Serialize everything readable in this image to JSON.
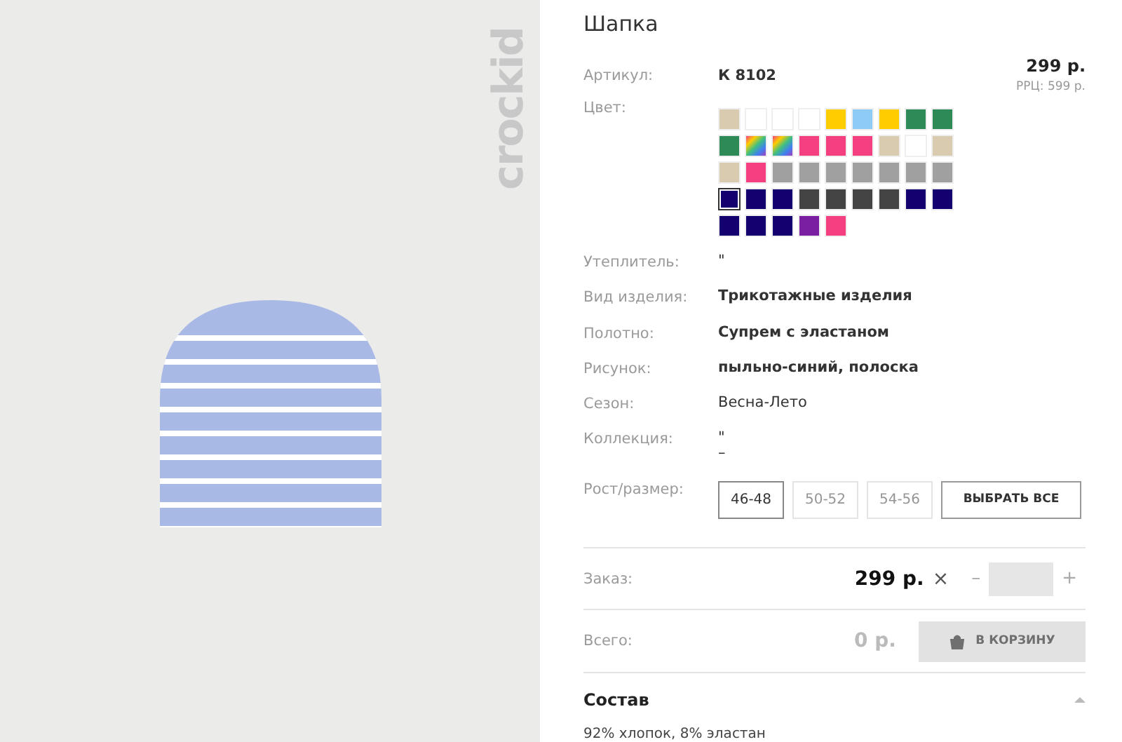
{
  "logo": {
    "text": "crockid"
  },
  "product": {
    "title": "Шапка",
    "article_label": "Артикул:",
    "article": "К 8102",
    "price": "299 р.",
    "rrp": "РРЦ: 599 р."
  },
  "color": {
    "label": "Цвет:",
    "swatches": [
      {
        "kind": "solid",
        "color": "#d8cbb0",
        "selected": false
      },
      {
        "kind": "solid",
        "color": "#ffffff",
        "selected": false
      },
      {
        "kind": "solid",
        "color": "#ffffff",
        "selected": false
      },
      {
        "kind": "solid",
        "color": "#ffffff",
        "selected": false
      },
      {
        "kind": "solid",
        "color": "#ffcc00",
        "selected": false
      },
      {
        "kind": "solid",
        "color": "#8ecbf5",
        "selected": false
      },
      {
        "kind": "solid",
        "color": "#ffcc00",
        "selected": false
      },
      {
        "kind": "solid",
        "color": "#2e8b57",
        "selected": false
      },
      {
        "kind": "solid",
        "color": "#2e8b57",
        "selected": false
      },
      {
        "kind": "solid",
        "color": "#2e8b57",
        "selected": false
      },
      {
        "kind": "rainbow",
        "selected": false
      },
      {
        "kind": "rainbow",
        "selected": false
      },
      {
        "kind": "solid",
        "color": "#f43f80",
        "selected": false
      },
      {
        "kind": "solid",
        "color": "#f43f80",
        "selected": false
      },
      {
        "kind": "solid",
        "color": "#f43f80",
        "selected": false
      },
      {
        "kind": "solid",
        "color": "#d8cbb0",
        "selected": false
      },
      {
        "kind": "solid",
        "color": "#ffffff",
        "selected": false
      },
      {
        "kind": "solid",
        "color": "#d8cbb0",
        "selected": false
      },
      {
        "kind": "solid",
        "color": "#d8cbb0",
        "selected": false
      },
      {
        "kind": "solid",
        "color": "#f43f80",
        "selected": false
      },
      {
        "kind": "solid",
        "color": "#a0a0a0",
        "selected": false
      },
      {
        "kind": "solid",
        "color": "#a0a0a0",
        "selected": false
      },
      {
        "kind": "solid",
        "color": "#a0a0a0",
        "selected": false
      },
      {
        "kind": "solid",
        "color": "#a0a0a0",
        "selected": false
      },
      {
        "kind": "solid",
        "color": "#a0a0a0",
        "selected": false
      },
      {
        "kind": "solid",
        "color": "#a0a0a0",
        "selected": false
      },
      {
        "kind": "solid",
        "color": "#a0a0a0",
        "selected": false
      },
      {
        "kind": "solid",
        "color": "#150070",
        "selected": true
      },
      {
        "kind": "solid",
        "color": "#150070",
        "selected": false
      },
      {
        "kind": "solid",
        "color": "#150070",
        "selected": false
      },
      {
        "kind": "solid",
        "color": "#444444",
        "selected": false
      },
      {
        "kind": "solid",
        "color": "#444444",
        "selected": false
      },
      {
        "kind": "solid",
        "color": "#444444",
        "selected": false
      },
      {
        "kind": "solid",
        "color": "#444444",
        "selected": false
      },
      {
        "kind": "solid",
        "color": "#150070",
        "selected": false
      },
      {
        "kind": "solid",
        "color": "#150070",
        "selected": false
      },
      {
        "kind": "solid",
        "color": "#150070",
        "selected": false
      },
      {
        "kind": "solid",
        "color": "#150070",
        "selected": false
      },
      {
        "kind": "solid",
        "color": "#150070",
        "selected": false
      },
      {
        "kind": "solid",
        "color": "#7a1fa2",
        "selected": false
      },
      {
        "kind": "solid",
        "color": "#f43f80",
        "selected": false
      }
    ]
  },
  "attributes": [
    {
      "label": "Утеплитель:",
      "value": "\"",
      "bold": false
    },
    {
      "label": "Вид изделия:",
      "value": "Трикотажные изделия",
      "bold": true
    },
    {
      "label": "Полотно:",
      "value": "Супрем с эластаном",
      "bold": true
    },
    {
      "label": "Рисунок:",
      "value": "пыльно-синий, полоска",
      "bold": true
    },
    {
      "label": "Сезон:",
      "value": "Весна-Лето",
      "bold": false
    },
    {
      "label": "Коллекция:",
      "value": "\"\n–",
      "bold": false
    }
  ],
  "sizes": {
    "label": "Рост/размер:",
    "options": [
      {
        "label": "46-48",
        "disabled": false
      },
      {
        "label": "50-52",
        "disabled": true
      },
      {
        "label": "54-56",
        "disabled": true
      }
    ],
    "select_all": "ВЫБРАТЬ ВСЕ"
  },
  "order": {
    "label": "Заказ:",
    "price": "299 р.",
    "times": "×",
    "minus": "–",
    "plus": "+"
  },
  "total": {
    "label": "Всего:",
    "value": "0 р.",
    "cart_button": "В КОРЗИНУ",
    "cart_disabled": true
  },
  "composition": {
    "title": "Состав",
    "expanded": true,
    "text": "92% хлопок, 8% эластан"
  }
}
